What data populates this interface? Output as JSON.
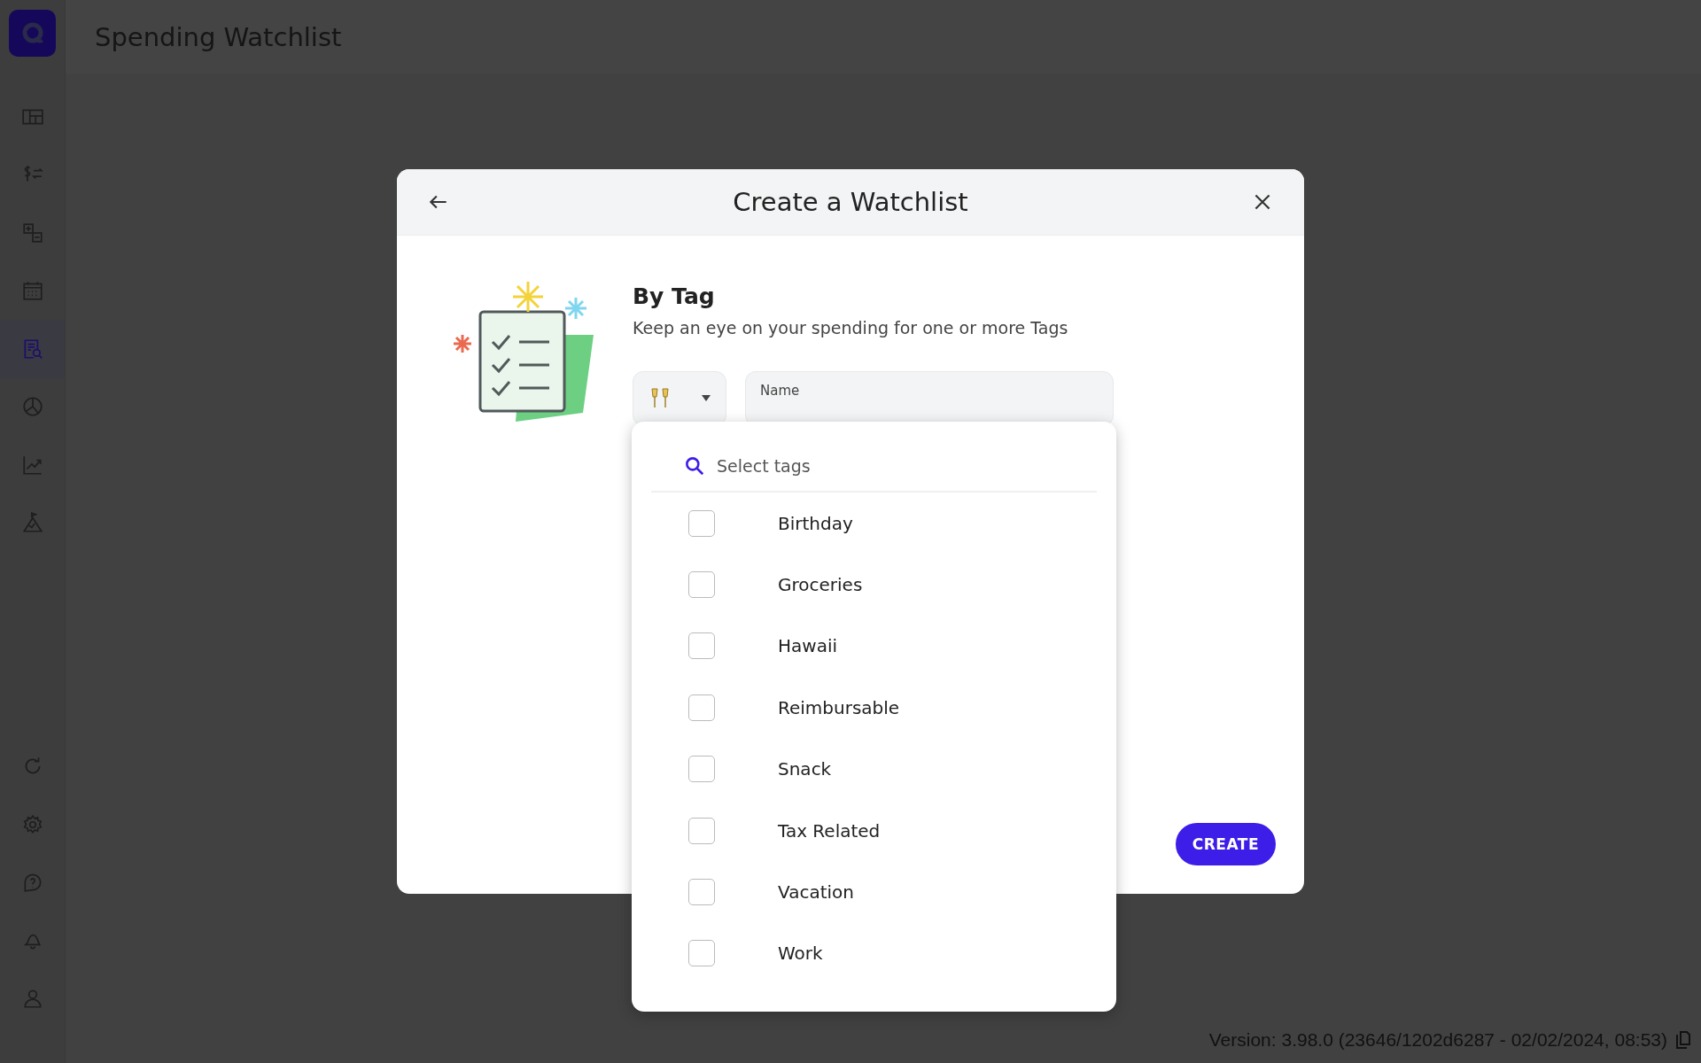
{
  "app": {
    "title": "Spending Watchlist"
  },
  "sidebar": {
    "nav": [
      {
        "kind": "dashboard",
        "selected": false
      },
      {
        "kind": "transactions",
        "selected": false
      },
      {
        "kind": "budget",
        "selected": false
      },
      {
        "kind": "calendar",
        "selected": false
      },
      {
        "kind": "watchlist",
        "selected": true
      },
      {
        "kind": "reports",
        "selected": false
      },
      {
        "kind": "trends",
        "selected": false
      },
      {
        "kind": "goals",
        "selected": false
      }
    ],
    "bottom": [
      {
        "kind": "refresh"
      },
      {
        "kind": "settings"
      },
      {
        "kind": "help"
      },
      {
        "kind": "notifications"
      },
      {
        "kind": "profile"
      }
    ]
  },
  "dialog": {
    "title": "Create a Watchlist",
    "heading": "By Tag",
    "description": "Keep an eye on your spending for one or more Tags",
    "name_field": {
      "label": "Name"
    },
    "tag_search": {
      "placeholder": "Select tags"
    },
    "tags": [
      {
        "label": "Birthday",
        "checked": false
      },
      {
        "label": "Groceries",
        "checked": false
      },
      {
        "label": "Hawaii",
        "checked": false
      },
      {
        "label": "Reimbursable",
        "checked": false
      },
      {
        "label": "Snack",
        "checked": false
      },
      {
        "label": "Tax Related",
        "checked": false
      },
      {
        "label": "Vacation",
        "checked": false
      },
      {
        "label": "Work",
        "checked": false
      }
    ],
    "create_button": "CREATE"
  },
  "version": "Version: 3.98.0 (23646/1202d6287 - 02/02/2024, 08:53)"
}
